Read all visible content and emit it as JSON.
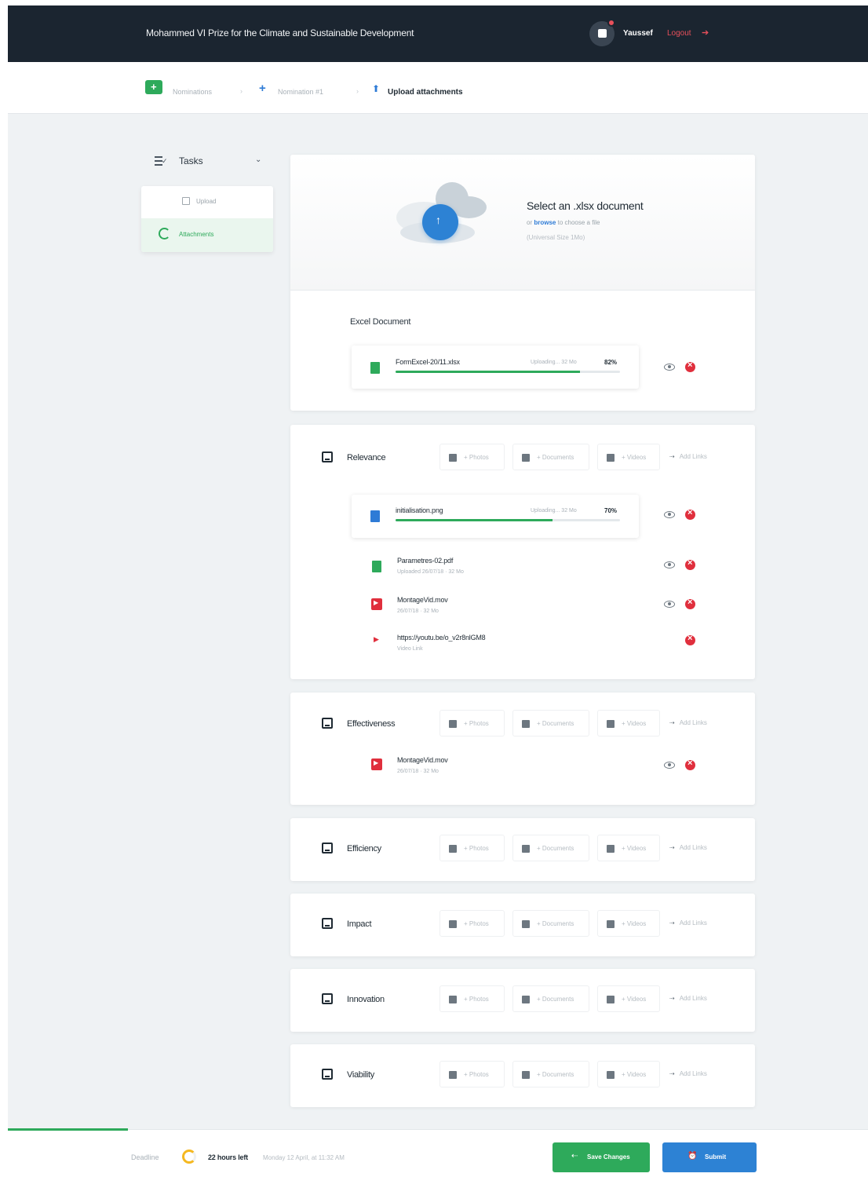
{
  "header": {
    "title": "Mohammed VI Prize for the Climate and Sustainable Development",
    "user_name": "Yaussef",
    "logout_label": "Logout"
  },
  "breadcrumb": {
    "items": [
      "Nominations",
      "Nomination #1",
      "Upload attachments"
    ]
  },
  "sidebar": {
    "section_label": "Tasks",
    "items": [
      {
        "label": "Upload"
      },
      {
        "label": "Attachments"
      }
    ]
  },
  "upload": {
    "title": "Select an .xlsx document",
    "subtitle_link": "browse",
    "subtitle_rest": "to choose a file",
    "subtitle_prefix": "or",
    "limit": "(Universal Size 1Mo)",
    "excel_section_title": "Excel Document",
    "excel_file": {
      "name": "FormExcel-20/11.xlsx",
      "status": "Uploading... 32 Mo",
      "percent": "82%",
      "progress": 0.82
    }
  },
  "categories": [
    {
      "title": "Relevance",
      "files": [
        {
          "name": "initialisation.png",
          "status": "Uploading... 32 Mo",
          "percent": "70%",
          "progress": 0.7,
          "type": "image"
        },
        {
          "name": "Parametres-02.pdf",
          "meta": "Uploaded 26/07/18 · 32 Mo",
          "type": "document"
        },
        {
          "name": "MontageVid.mov",
          "meta": "26/07/18 · 32 Mo",
          "type": "video"
        },
        {
          "name": "https://youtu.be/o_v2r8nlGM8",
          "meta": "Video Link",
          "type": "link"
        }
      ]
    },
    {
      "title": "Effectiveness",
      "files": [
        {
          "name": "MontageVid.mov",
          "meta": "26/07/18 · 32 Mo",
          "type": "video"
        }
      ]
    },
    {
      "title": "Efficiency",
      "files": []
    },
    {
      "title": "Impact",
      "files": []
    },
    {
      "title": "Innovation",
      "files": []
    },
    {
      "title": "Viability",
      "files": []
    }
  ],
  "actions": {
    "photos": "+ Photos",
    "documents": "+ Documents",
    "videos": "+ Videos",
    "links": "Add Links"
  },
  "footer": {
    "deadline_label": "Deadline",
    "hours_left": "22 hours left",
    "deadline_date": "Monday 12 April, at 11:32 AM",
    "save_label": "Save Changes",
    "submit_label": "Submit",
    "overall_progress": 0.14
  },
  "colors": {
    "header_bg": "#1b2530",
    "accent_green": "#2eaa5b",
    "accent_blue": "#2d82d4",
    "danger_red": "#e02f3d",
    "deadline_yellow": "#f5b820"
  }
}
